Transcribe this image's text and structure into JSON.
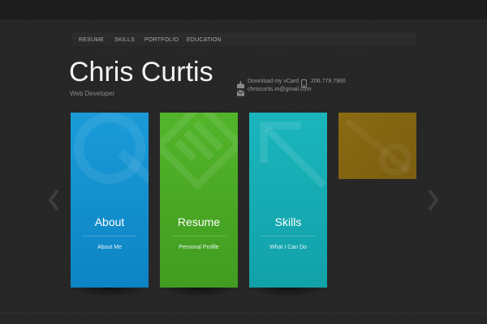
{
  "nav": {
    "items": [
      "RESUME",
      "SKILLS",
      "PORTFOLIO",
      "EDUCATION"
    ]
  },
  "header": {
    "title": "Chris Curtis",
    "subtitle": "Web Developer"
  },
  "contact": {
    "vcard": "Download my vCard",
    "phone": "206.779.7960",
    "email": "chriscurtis.m@gmail.com"
  },
  "tiles": [
    {
      "title": "About",
      "subtitle": "About Me",
      "color": "#0f8fd0",
      "icon": "magnifier-icon"
    },
    {
      "title": "Resume",
      "subtitle": "Personal Profile",
      "color": "#4aaa24",
      "icon": "document-icon"
    },
    {
      "title": "Skills",
      "subtitle": "What I Can Do",
      "color": "#15aab3",
      "icon": "arrow-up-left-icon"
    },
    {
      "title": "",
      "subtitle": "",
      "color": "#8a6a12",
      "icon": "partial-tile"
    }
  ],
  "colors": {
    "background": "#262626",
    "nav_text": "#a8a8a8",
    "title": "#f2f2f2"
  }
}
